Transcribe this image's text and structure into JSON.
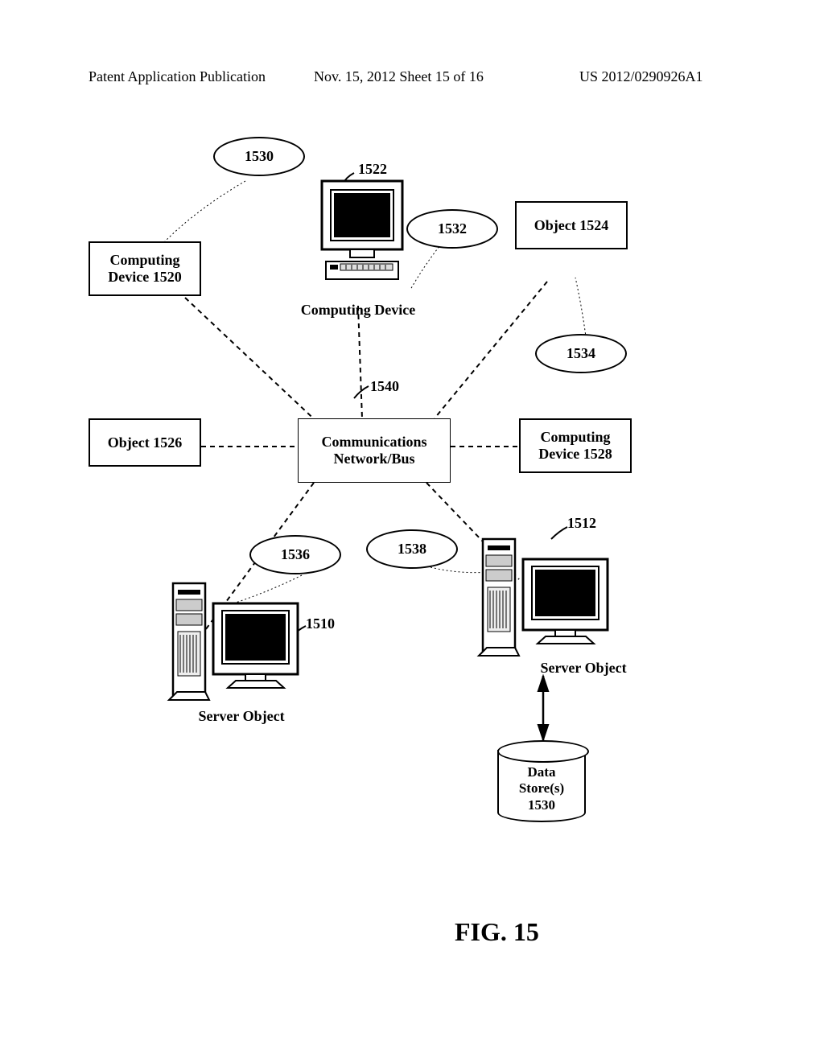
{
  "header": {
    "left": "Patent Application Publication",
    "center": "Nov. 15, 2012  Sheet 15 of 16",
    "right": "US 2012/0290926A1"
  },
  "diagram": {
    "computing_device_1520": "Computing\nDevice 1520",
    "object_1524": "Object 1524",
    "object_1526": "Object 1526",
    "computing_device_1528": "Computing\nDevice 1528",
    "computing_device_label": "Computing Device",
    "comm_network": "Communications\nNetwork/Bus",
    "server_object_left": "Server Object",
    "server_object_right": "Server Object",
    "data_store": "Data\nStore(s)\n1530"
  },
  "refs": {
    "r1530": "1530",
    "r1522": "1522",
    "r1532": "1532",
    "r1534": "1534",
    "r1540": "1540",
    "r1536": "1536",
    "r1538": "1538",
    "r1510": "1510",
    "r1512": "1512"
  },
  "figure_label": "FIG. 15"
}
